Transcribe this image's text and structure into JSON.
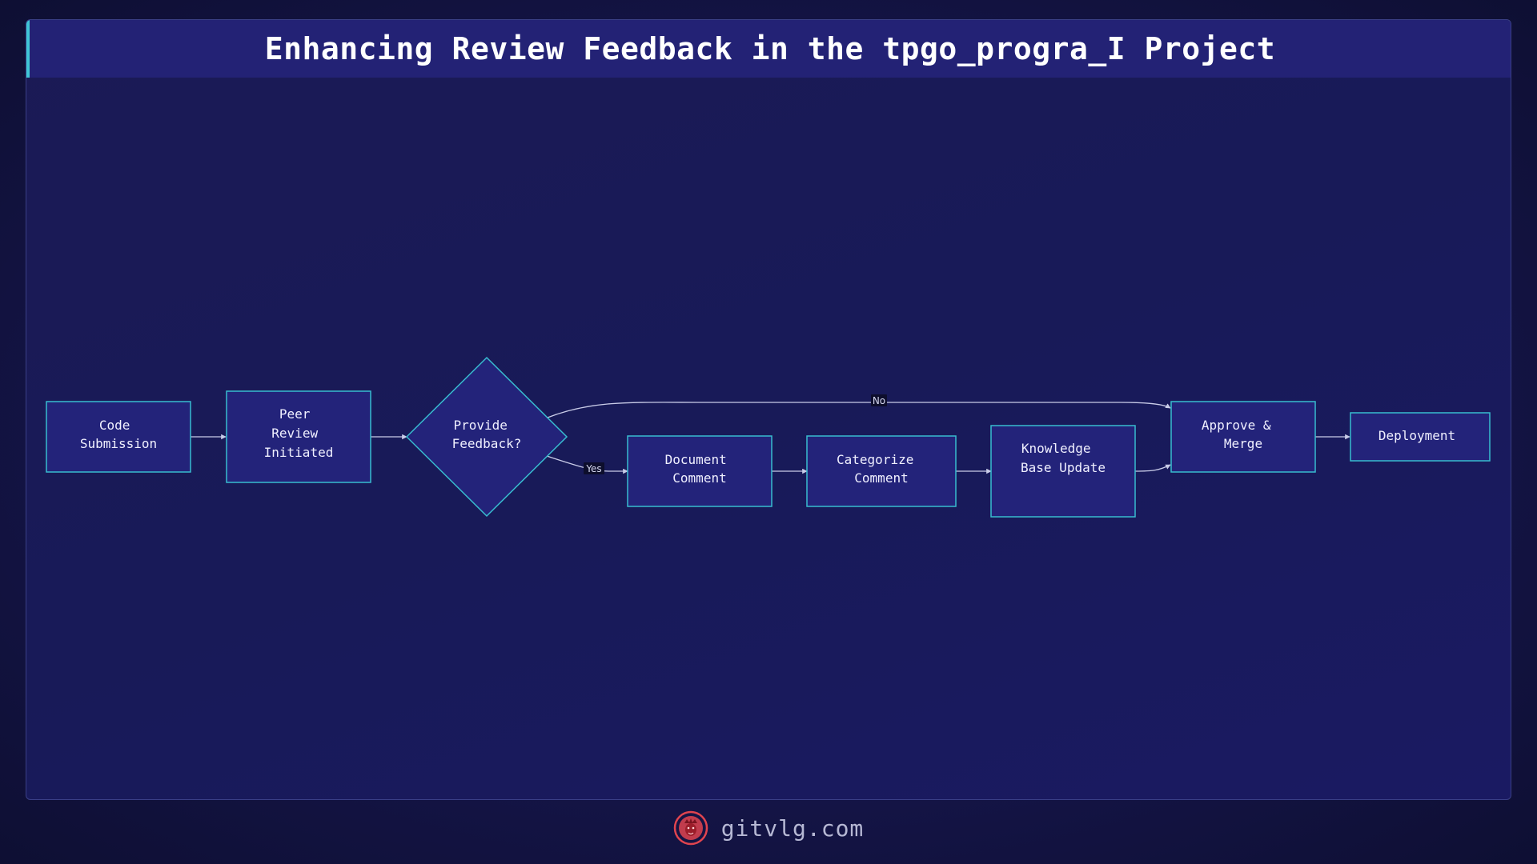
{
  "title": "Enhancing Review Feedback in the tpgo_progra_I Project",
  "nodes": {
    "code_submission": [
      "Code",
      "Submission"
    ],
    "peer_review": [
      "Peer",
      "Review",
      "Initiated"
    ],
    "provide_feedback": [
      "Provide",
      "Feedback?"
    ],
    "document_comment": [
      "Document",
      "Comment"
    ],
    "categorize_comment": [
      "Categorize",
      "Comment"
    ],
    "knowledge_base": [
      "Knowledge",
      "Base Update"
    ],
    "approve_merge": [
      "Approve &",
      "Merge"
    ],
    "deployment": [
      "Deployment"
    ]
  },
  "edge_labels": {
    "yes": "Yes",
    "no": "No"
  },
  "colors": {
    "node_fill": "#23237a",
    "node_stroke": "#38bcd0",
    "title_accent": "#3fc6d6",
    "logo": "#e0444f"
  },
  "footer": {
    "logo_icon": "lion-head-icon",
    "site": "gitvlg.com"
  }
}
